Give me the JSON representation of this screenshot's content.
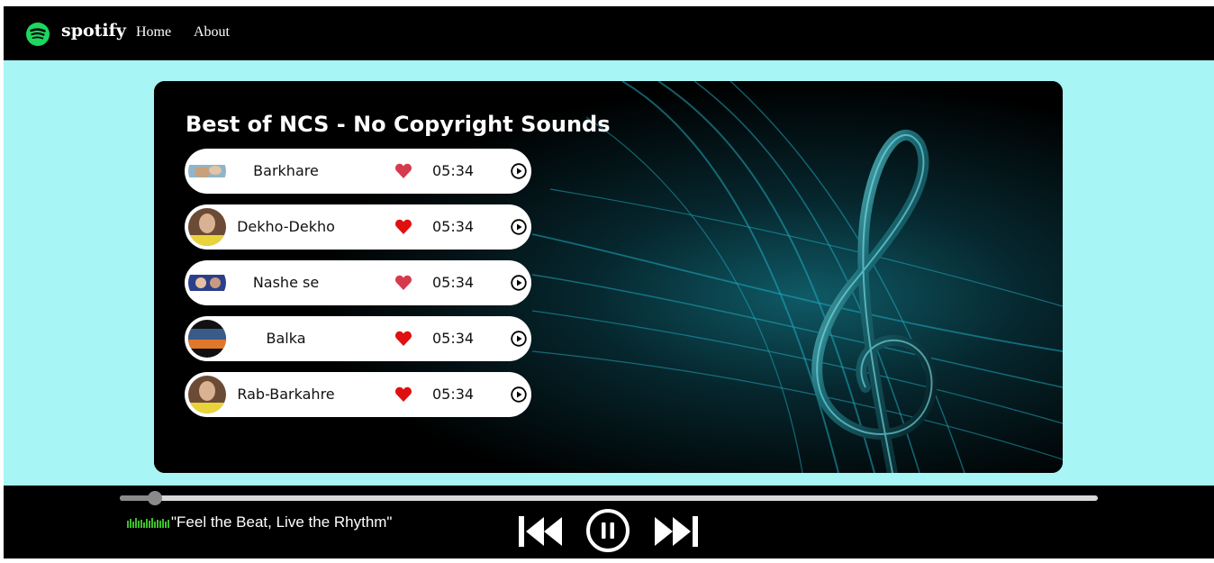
{
  "nav": {
    "brand": "spotify",
    "links": [
      {
        "label": "Home"
      },
      {
        "label": "About"
      }
    ]
  },
  "playlist": {
    "title": "Best of NCS - No Copyright Sounds",
    "songs": [
      {
        "name": "Barkhare",
        "duration": "05:34"
      },
      {
        "name": "Dekho-Dekho",
        "duration": "05:34"
      },
      {
        "name": "Nashe se",
        "duration": "05:34"
      },
      {
        "name": "Balka",
        "duration": "05:34"
      },
      {
        "name": "Rab-Barkahre",
        "duration": "05:34"
      }
    ]
  },
  "player": {
    "song_info": "\"Feel the Beat, Live the Rhythm\"",
    "progress": 0.036
  },
  "colors": {
    "accent_green": "#1ed760",
    "heart_red": "#e52424",
    "page_bg": "#a8f5f5"
  }
}
